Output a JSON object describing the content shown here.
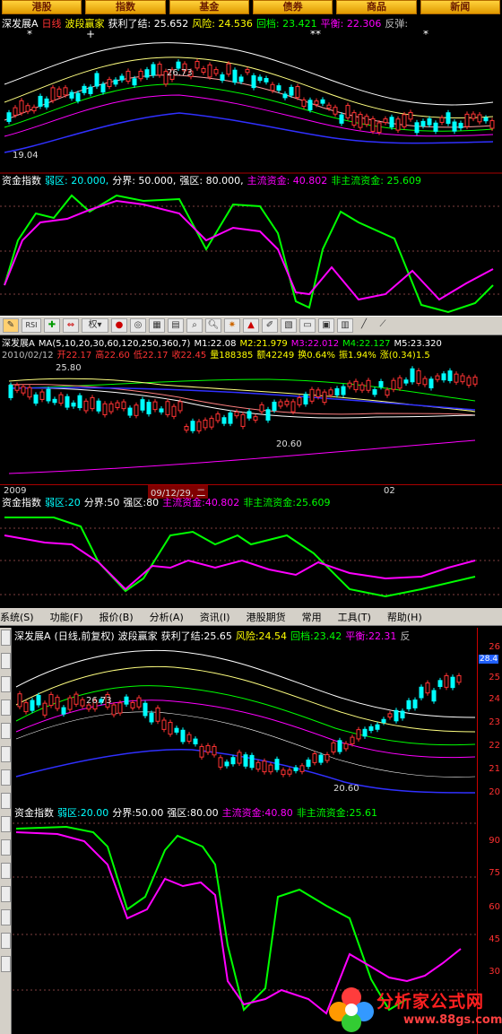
{
  "nav_tabs": [
    "港股",
    "指数",
    "基金",
    "债券",
    "商品",
    "新闻"
  ],
  "p1": {
    "header": {
      "name": "深发展A",
      "period": "日线",
      "indicator": "波段赢家",
      "profit": "获利了结: 25.652",
      "risk": "风险: 24.536",
      "pullback": "回档: 23.421",
      "balance": "平衡: 22.306",
      "reverse": "反弹:"
    },
    "high_label": "26.73",
    "low_label": "19.04",
    "sub_header": {
      "name": "资金指数",
      "weak": "弱区: 20.000,",
      "boundary": "分界: 50.000,",
      "strong": "强区: 80.000,",
      "main": "主流资金: 40.802",
      "nonmain": "非主流资金: 25.609"
    }
  },
  "toolbar": {
    "rsi": "RSI",
    "quan": "权"
  },
  "p2": {
    "header": {
      "name": "深发展A",
      "ma": "MA(5,10,20,30,60,120,250,360,7)",
      "m1": "M1:22.08",
      "m2": "M2:21.979",
      "m3": "M3:22.012",
      "m4": "M4:22.127",
      "m5": "M5:23.320"
    },
    "quote": {
      "date": "2010/02/12",
      "open": "开22.17",
      "high": "高22.60",
      "low": "低22.17",
      "close": "收22.45",
      "vol": "量188385",
      "amt": "额42249",
      "turn": "换0.64%",
      "amp": "振1.94%",
      "chg": "涨(0.34)1.5"
    },
    "high_label": "25.80",
    "low_label": "20.60",
    "axis": {
      "year": "2009",
      "cursor_date": "09/12/29, 二",
      "month": "02"
    },
    "sub_header": {
      "name": "资金指数",
      "weak": "弱区:20",
      "boundary": "分界:50",
      "strong": "强区:80",
      "main": "主流资金:40.802",
      "nonmain": "非主流资金:25.609"
    }
  },
  "menu": [
    "系统(S)",
    "功能(F)",
    "报价(B)",
    "分析(A)",
    "资讯(I)",
    "港股期货",
    "常用",
    "工具(T)",
    "帮助(H)"
  ],
  "p3": {
    "header": {
      "name": "深发展A",
      "period": "(日线,前复权)",
      "indicator": "波段赢家",
      "profit": "获利了结:25.65",
      "risk": "风险:24.54",
      "pullback": "回档:23.42",
      "balance": "平衡:22.31",
      "reverse": "反"
    },
    "high_label": "26.73",
    "low_label": "20.60",
    "price_ticks": [
      "26",
      "25",
      "24",
      "23",
      "22",
      "21",
      "20"
    ],
    "price_tag": "28.4",
    "sub_header": {
      "name": "资金指数",
      "weak": "弱区:20.00",
      "boundary": "分界:50.00",
      "strong": "强区:80.00",
      "main": "主流资金:40.80",
      "nonmain": "非主流资金:25.61"
    },
    "ind_ticks": [
      "90",
      "75",
      "60",
      "45",
      "30"
    ]
  },
  "logo": {
    "title": "分析家公式网",
    "url": "www.88gs.com"
  }
}
